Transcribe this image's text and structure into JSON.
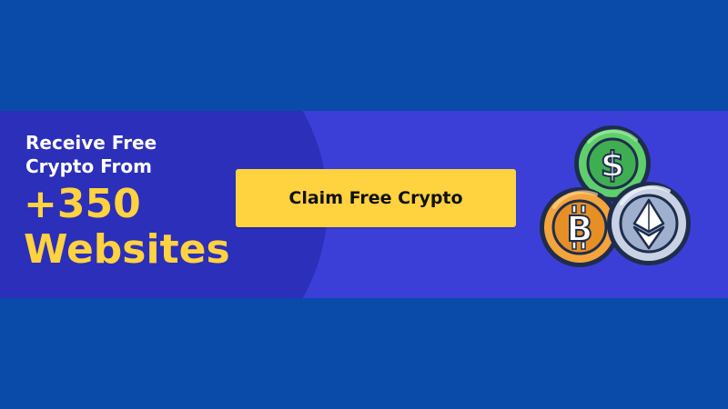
{
  "banner": {
    "headline_line1": "Receive Free",
    "headline_line2": "Crypto From",
    "big_number": "+350",
    "big_word": "Websites",
    "cta_label": "Claim Free Crypto"
  },
  "coins": {
    "dollar_glyph": "$",
    "bitcoin_glyph": "B",
    "icons": [
      "dollar-coin-icon",
      "bitcoin-coin-icon",
      "ethereum-coin-icon"
    ]
  },
  "colors": {
    "page_background": "#0a4aa8",
    "banner_background": "#3b3fd8",
    "banner_dark_arc": "#2b2fb9",
    "accent_yellow": "#ffd23f",
    "headline_white": "#ffffff",
    "dollar_coin_green": "#5fcf6b",
    "bitcoin_coin_orange": "#f3a43b",
    "ethereum_coin_silver": "#c9d2e3",
    "coin_outline": "#1f2d4d"
  }
}
